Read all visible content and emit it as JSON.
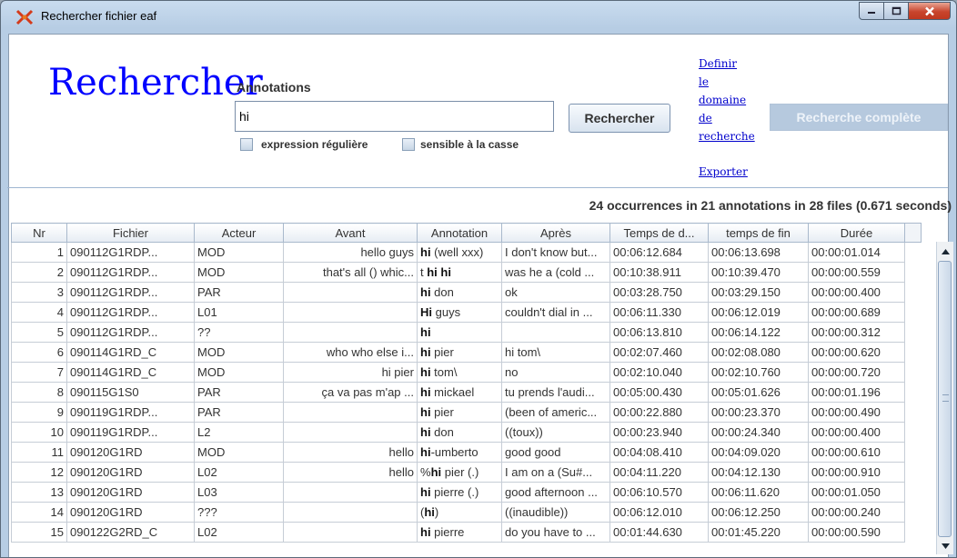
{
  "window": {
    "title": "Rechercher fichier eaf"
  },
  "search": {
    "heading": "Rechercher",
    "annotations_label": "Annotations",
    "query_value": "hi",
    "regex_label": "expression régulière",
    "case_label": "sensible à la casse",
    "search_button": "Rechercher",
    "full_search_button": "Recherche complète"
  },
  "links": {
    "define_domain_lines": [
      "Definir",
      "le",
      "domaine",
      "de",
      "recherche"
    ],
    "export": "Exporter"
  },
  "summary": "24 occurrences in 21 annotations  in 28 files (0.671 seconds)",
  "table": {
    "columns": [
      "Nr",
      "Fichier",
      "Acteur",
      "Avant",
      "Annotation",
      "Après",
      "Temps de d...",
      "temps de fin",
      "Durée"
    ],
    "rows": [
      {
        "nr": "1",
        "file": "090112G1RDP...",
        "actor": "MOD",
        "before": "hello guys",
        "pre": "",
        "hit": "hi",
        "post": " (well xxx)",
        "after": "I don't know but...",
        "start": "00:06:12.684",
        "end": "00:06:13.698",
        "dur": "00:00:01.014"
      },
      {
        "nr": "2",
        "file": "090112G1RDP...",
        "actor": "MOD",
        "before": "that's all () whic...",
        "pre": "t ",
        "hit": "hi hi",
        "post": "",
        "after": "was he a (cold ...",
        "start": "00:10:38.911",
        "end": "00:10:39.470",
        "dur": "00:00:00.559"
      },
      {
        "nr": "3",
        "file": "090112G1RDP...",
        "actor": "PAR",
        "before": "",
        "pre": "",
        "hit": "hi",
        "post": " don",
        "after": "ok",
        "start": "00:03:28.750",
        "end": "00:03:29.150",
        "dur": "00:00:00.400"
      },
      {
        "nr": "4",
        "file": "090112G1RDP...",
        "actor": "L01",
        "before": "",
        "pre": "",
        "hit": "Hi",
        "post": " guys",
        "after": "couldn't dial in ...",
        "start": "00:06:11.330",
        "end": "00:06:12.019",
        "dur": "00:00:00.689"
      },
      {
        "nr": "5",
        "file": "090112G1RDP...",
        "actor": "??",
        "before": "",
        "pre": "",
        "hit": "hi",
        "post": "",
        "after": "",
        "start": "00:06:13.810",
        "end": "00:06:14.122",
        "dur": "00:00:00.312"
      },
      {
        "nr": "6",
        "file": "090114G1RD_C",
        "actor": "MOD",
        "before": "who who else i...",
        "pre": "",
        "hit": "hi",
        "post": " pier",
        "after": "hi tom\\",
        "start": "00:02:07.460",
        "end": "00:02:08.080",
        "dur": "00:00:00.620"
      },
      {
        "nr": "7",
        "file": "090114G1RD_C",
        "actor": "MOD",
        "before": "hi pier",
        "pre": "",
        "hit": "hi",
        "post": " tom\\",
        "after": "no",
        "start": "00:02:10.040",
        "end": "00:02:10.760",
        "dur": "00:00:00.720"
      },
      {
        "nr": "8",
        "file": "090115G1S0",
        "actor": "PAR",
        "before": "ça va pas m'ap ...",
        "pre": "",
        "hit": "hi",
        "post": " mickael",
        "after": "tu prends l'audi...",
        "start": "00:05:00.430",
        "end": "00:05:01.626",
        "dur": "00:00:01.196"
      },
      {
        "nr": "9",
        "file": "090119G1RDP...",
        "actor": "PAR",
        "before": "",
        "pre": "",
        "hit": "hi",
        "post": " pier",
        "after": "(been of americ...",
        "start": "00:00:22.880",
        "end": "00:00:23.370",
        "dur": "00:00:00.490"
      },
      {
        "nr": "10",
        "file": "090119G1RDP...",
        "actor": "L2",
        "before": "",
        "pre": "",
        "hit": "hi",
        "post": " don",
        "after": "((toux))",
        "start": "00:00:23.940",
        "end": "00:00:24.340",
        "dur": "00:00:00.400"
      },
      {
        "nr": "11",
        "file": "090120G1RD",
        "actor": "MOD",
        "before": "hello",
        "pre": "",
        "hit": "hi",
        "post": "-umberto",
        "after": "good good",
        "start": "00:04:08.410",
        "end": "00:04:09.020",
        "dur": "00:00:00.610"
      },
      {
        "nr": "12",
        "file": "090120G1RD",
        "actor": "L02",
        "before": "hello",
        "pre": "%",
        "hit": "hi",
        "post": " pier (.)",
        "after": "I am on a (Su#...",
        "start": "00:04:11.220",
        "end": "00:04:12.130",
        "dur": "00:00:00.910"
      },
      {
        "nr": "13",
        "file": "090120G1RD",
        "actor": "L03",
        "before": "",
        "pre": "",
        "hit": "hi",
        "post": " pierre (.)",
        "after": "good afternoon ...",
        "start": "00:06:10.570",
        "end": "00:06:11.620",
        "dur": "00:00:01.050"
      },
      {
        "nr": "14",
        "file": "090120G1RD",
        "actor": "???",
        "before": "",
        "pre": "(",
        "hit": "hi",
        "post": ")",
        "after": "((inaudible))",
        "start": "00:06:12.010",
        "end": "00:06:12.250",
        "dur": "00:00:00.240"
      },
      {
        "nr": "15",
        "file": "090122G2RD_C",
        "actor": "L02",
        "before": "",
        "pre": "",
        "hit": "hi",
        "post": " pierre",
        "after": "do you have to ...",
        "start": "00:01:44.630",
        "end": "00:01:45.220",
        "dur": "00:00:00.590"
      }
    ]
  },
  "colors": {
    "heading": "#0000ff",
    "link": "#0000cc",
    "close": "#c8452d"
  },
  "icons": [
    "app-logo-icon",
    "minimize-icon",
    "maximize-icon",
    "close-icon",
    "scroll-up-icon",
    "scroll-down-icon"
  ]
}
